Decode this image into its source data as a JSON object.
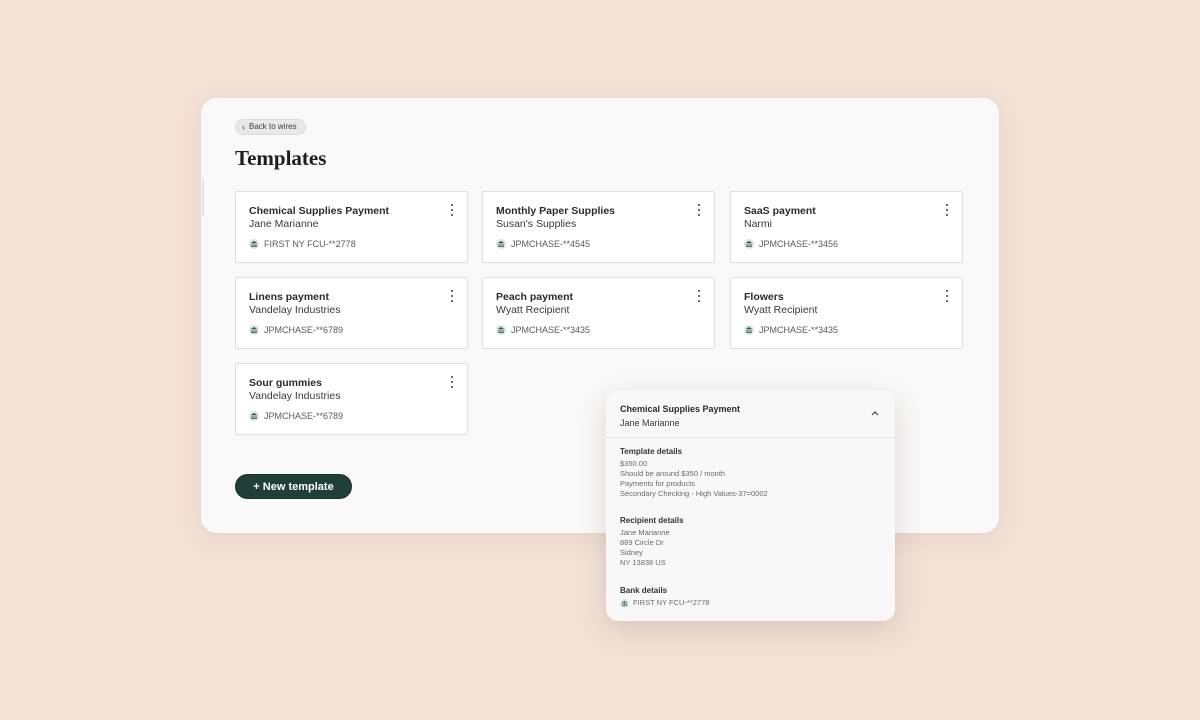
{
  "header": {
    "back_label": "Back to wires",
    "title": "Templates"
  },
  "cards": [
    {
      "title": "Chemical Supplies Payment",
      "recipient": "Jane Marianne",
      "bank": "FIRST NY FCU-**2778"
    },
    {
      "title": "Monthly Paper Supplies",
      "recipient": "Susan's Supplies",
      "bank": "JPMCHASE-**4545"
    },
    {
      "title": "SaaS payment",
      "recipient": "Narmi",
      "bank": "JPMCHASE-**3456"
    },
    {
      "title": "Linens payment",
      "recipient": "Vandelay Industries",
      "bank": "JPMCHASE-**6789"
    },
    {
      "title": "Peach payment",
      "recipient": "Wyatt Recipient",
      "bank": "JPMCHASE-**3435"
    },
    {
      "title": "Flowers",
      "recipient": "Wyatt Recipient",
      "bank": "JPMCHASE-**3435"
    },
    {
      "title": "Sour gummies",
      "recipient": "Vandelay Industries",
      "bank": "JPMCHASE-**6789"
    }
  ],
  "new_template_label": "+ New template",
  "detail": {
    "title": "Chemical Supplies Payment",
    "recipient": "Jane Marianne",
    "template_details": {
      "heading": "Template details",
      "amount": "$350.00",
      "note": "Should be around $350 / month",
      "memo": "Payments for products",
      "account": "Secondary Checking - High Values-37=0002"
    },
    "recipient_details": {
      "heading": "Recipient details",
      "name": "Jane Marianne",
      "street": "889 Circle Dr",
      "city": "Sidney",
      "region": "NY 13838 US"
    },
    "bank_details": {
      "heading": "Bank details",
      "bank": "FIRST NY FCU-**2778"
    }
  },
  "icons": {
    "bank": "bank-icon",
    "menu": "kebab-menu-icon",
    "back": "chevron-left-icon",
    "collapse": "chevron-up-icon"
  },
  "colors": {
    "background": "#f4e2d7",
    "primary_button": "#1f3f37"
  }
}
